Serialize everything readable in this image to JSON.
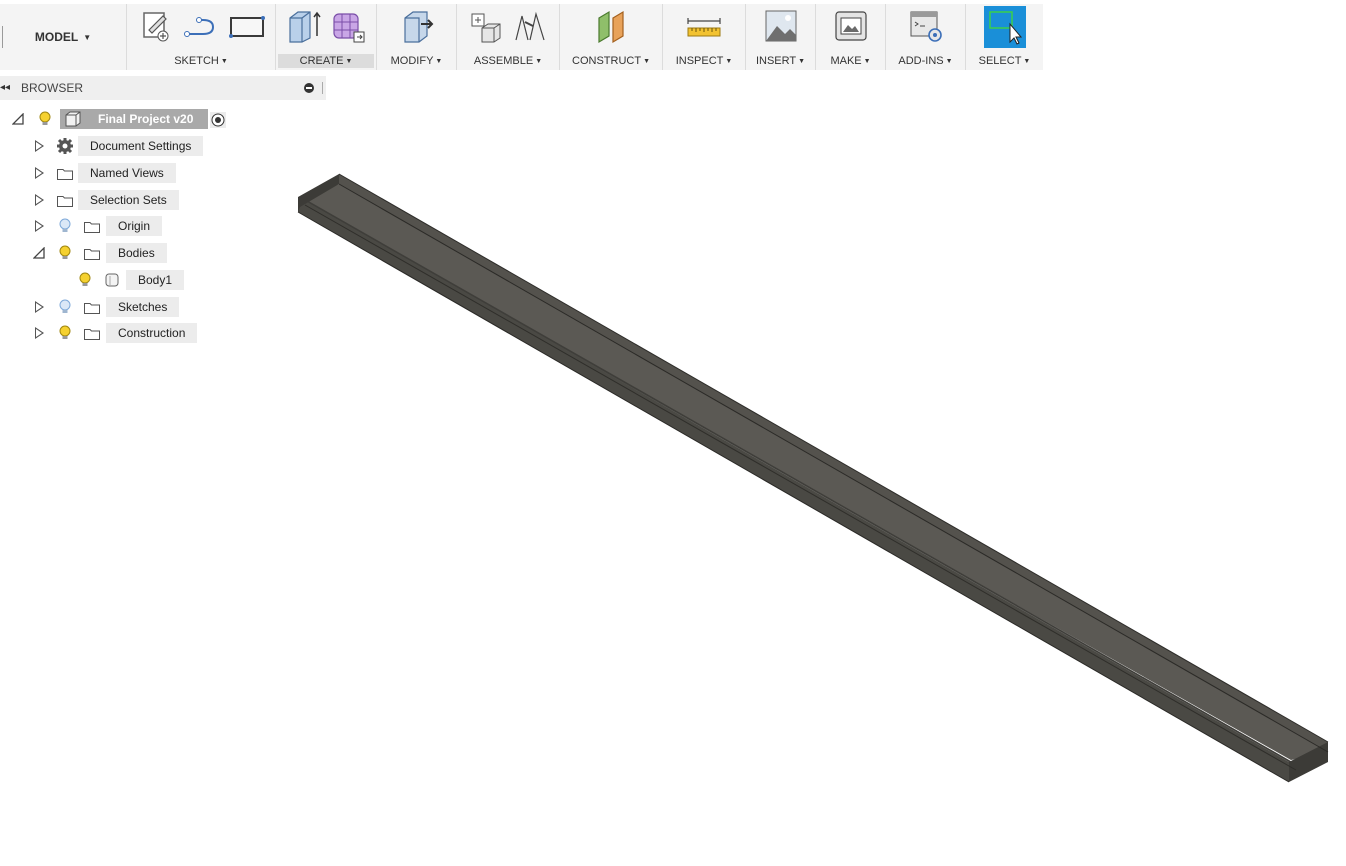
{
  "toolbar": {
    "workspace": "MODEL",
    "groups": [
      {
        "label": "SKETCH",
        "icons": [
          "create-sketch-icon",
          "line-icon",
          "rectangle-icon"
        ]
      },
      {
        "label": "CREATE",
        "icons": [
          "extrude-icon",
          "form-icon"
        ]
      },
      {
        "label": "MODIFY",
        "icons": [
          "press-pull-icon"
        ]
      },
      {
        "label": "ASSEMBLE",
        "icons": [
          "new-component-icon",
          "joint-icon"
        ]
      },
      {
        "label": "CONSTRUCT",
        "icons": [
          "offset-plane-icon"
        ]
      },
      {
        "label": "INSPECT",
        "icons": [
          "measure-icon"
        ]
      },
      {
        "label": "INSERT",
        "icons": [
          "insert-image-icon"
        ]
      },
      {
        "label": "MAKE",
        "icons": [
          "3d-print-icon"
        ]
      },
      {
        "label": "ADD-INS",
        "icons": [
          "scripts-addins-icon"
        ]
      },
      {
        "label": "SELECT",
        "icons": [
          "select-icon"
        ]
      }
    ],
    "active_group": "CREATE"
  },
  "browser": {
    "title": "BROWSER",
    "root": "Final Project v20",
    "items": [
      {
        "label": "Document Settings",
        "icon": "gear-icon",
        "expanded": false
      },
      {
        "label": "Named Views",
        "icon": "folder-icon",
        "expanded": false
      },
      {
        "label": "Selection Sets",
        "icon": "folder-icon",
        "expanded": false
      },
      {
        "label": "Origin",
        "icon": "folder-icon",
        "bulb": "off",
        "expanded": false
      },
      {
        "label": "Bodies",
        "icon": "folder-icon",
        "bulb": "on",
        "expanded": true
      },
      {
        "label": "Body1",
        "icon": "body-icon",
        "bulb": "on"
      },
      {
        "label": "Sketches",
        "icon": "folder-icon",
        "bulb": "off",
        "expanded": false
      },
      {
        "label": "Construction",
        "icon": "folder-icon",
        "bulb": "on",
        "expanded": false
      }
    ]
  },
  "colors": {
    "toolbar_bg": "#f4f4f4",
    "select_accent": "#1a8fd8",
    "bulb_on": "#f5d130",
    "bulb_off": "#7ea9d9",
    "body_dark": "#4a4944",
    "body_light": "#5c5a55",
    "canvas_bg": "#ffffff"
  }
}
